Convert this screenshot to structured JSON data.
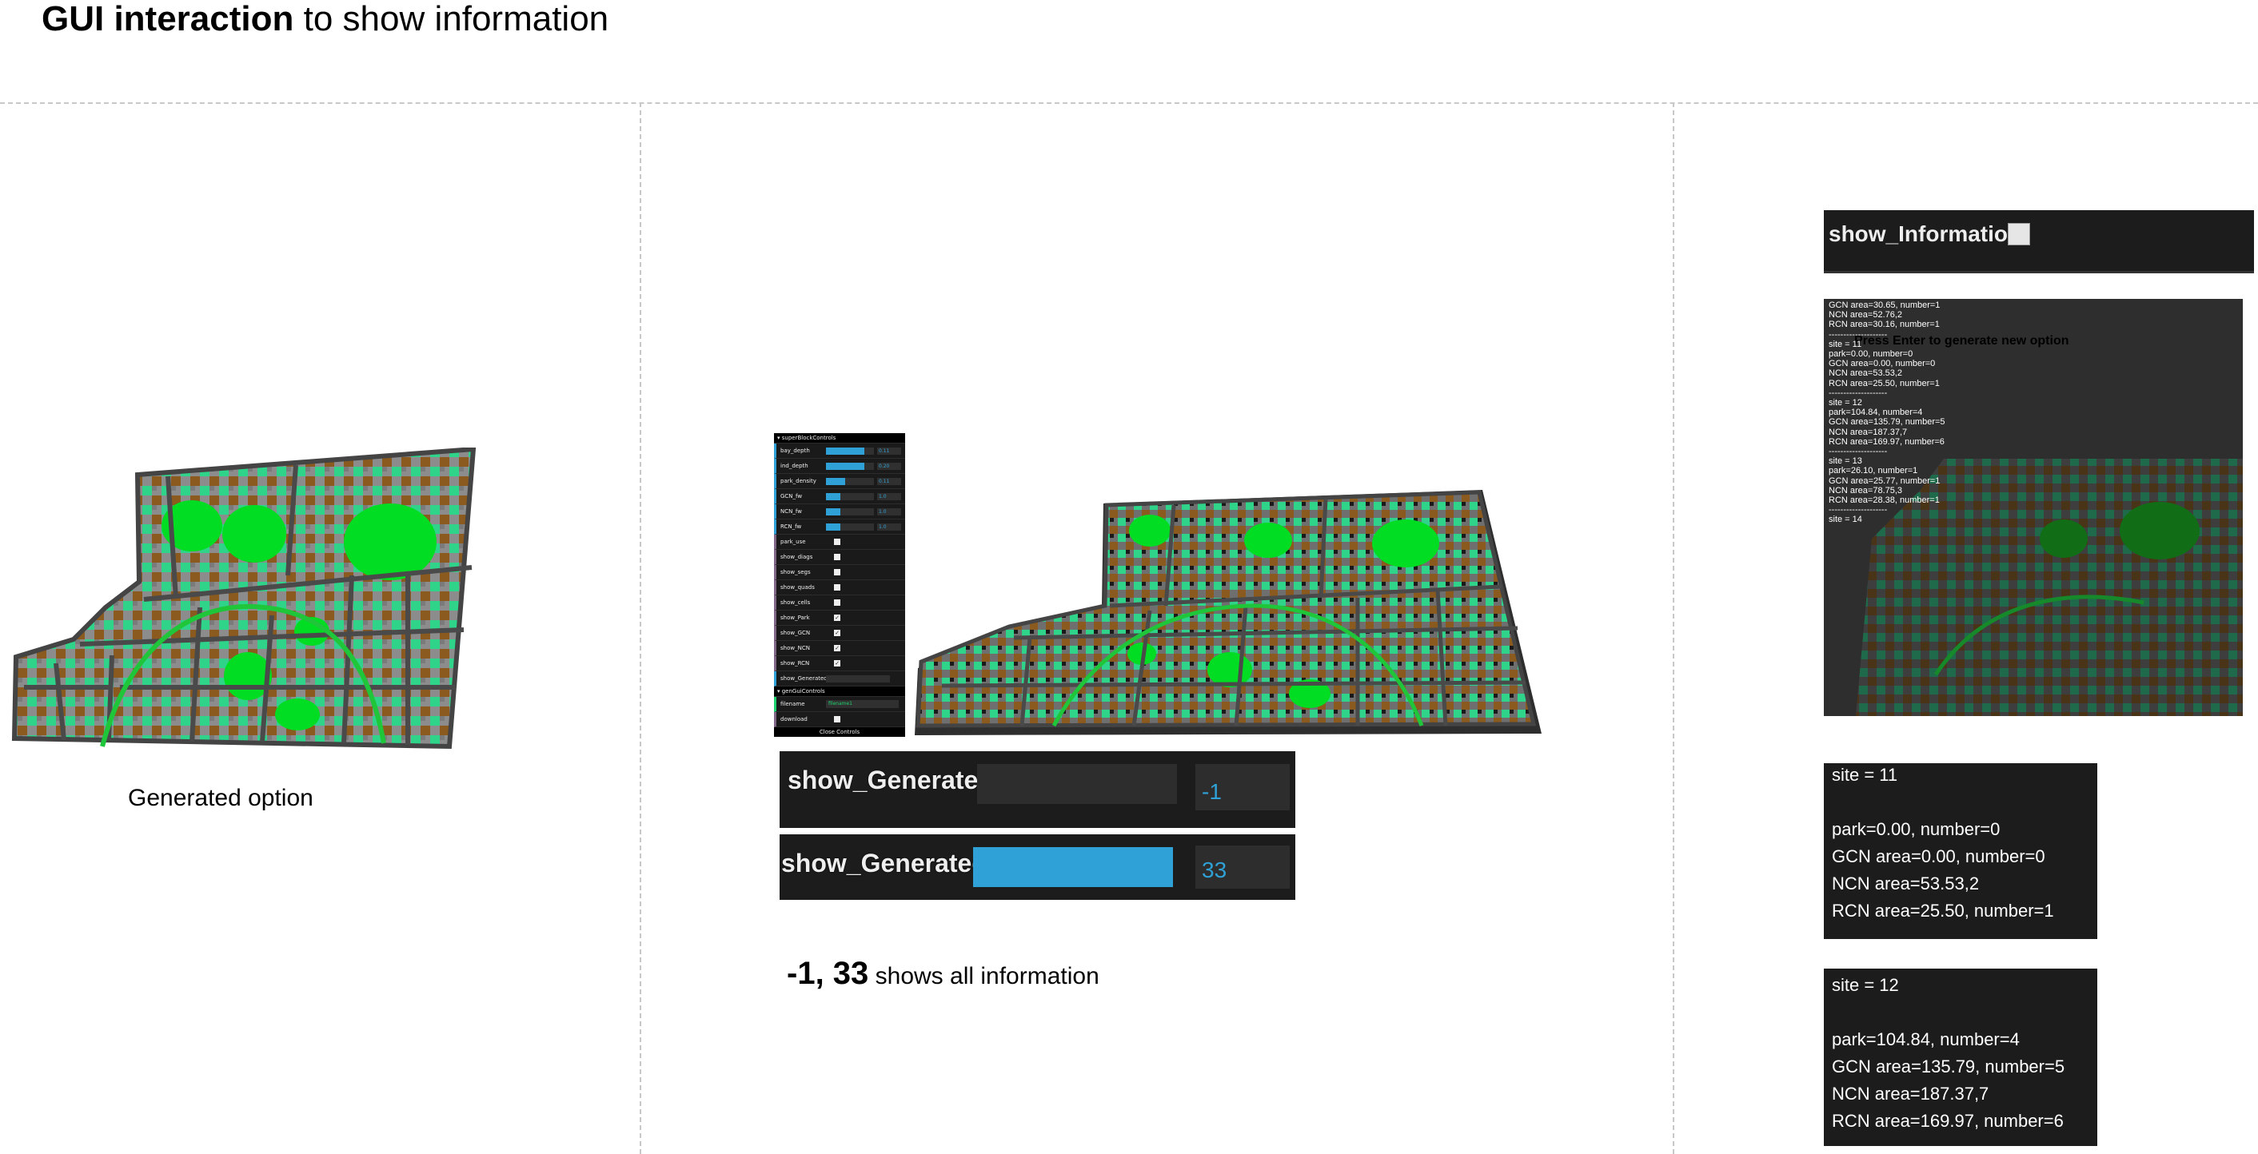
{
  "title": {
    "bold": "GUI interaction",
    "rest": "to show information"
  },
  "captions": {
    "generated": "Generated option",
    "shows_bold": "-1, 33",
    "shows_rest": "shows all information"
  },
  "gui": {
    "folder1": "▾ superBlockControls",
    "number_rows": [
      {
        "label": "bay_depth",
        "value": "0.11",
        "fill": 0.8
      },
      {
        "label": "ind_depth",
        "value": "0.20",
        "fill": 0.8
      },
      {
        "label": "park_density",
        "value": "0.11",
        "fill": 0.4
      },
      {
        "label": "GCN_fw",
        "value": "1.0",
        "fill": 0.3
      },
      {
        "label": "NCN_fw",
        "value": "1.0",
        "fill": 0.3
      },
      {
        "label": "RCN_fw",
        "value": "1.0",
        "fill": 0.3
      }
    ],
    "bool_rows": [
      {
        "label": "park_use",
        "checked": false
      },
      {
        "label": "show_diags",
        "checked": false
      },
      {
        "label": "show_segs",
        "checked": false
      },
      {
        "label": "show_quads",
        "checked": false
      },
      {
        "label": "show_cells",
        "checked": false
      },
      {
        "label": "show_Park",
        "checked": true
      },
      {
        "label": "show_GCN",
        "checked": true
      },
      {
        "label": "show_NCN",
        "checked": true
      },
      {
        "label": "show_RCN",
        "checked": true
      }
    ],
    "generated_label": "show_Generated",
    "folder2": "▾ genGuiControls",
    "filename_label": "filename",
    "filename_value": "filename1",
    "download_label": "download",
    "close": "Close Controls"
  },
  "show_generated": {
    "label": "show_Generated",
    "low_value": "-1",
    "high_value": "33",
    "low_fill": 0,
    "high_fill": 1
  },
  "show_information": {
    "label": "show_Information",
    "checked": false
  },
  "info_overlay": {
    "press_enter": "Press Enter to generate new option",
    "lines": [
      "GCN area=30.65, number=1",
      "NCN area=52.76,2",
      "RCN area=30.16, number=1",
      "--------------------",
      "site = 11",
      "park=0.00, number=0",
      "GCN area=0.00, number=0",
      "NCN area=53.53,2",
      "RCN area=25.50, number=1",
      "--------------------",
      "site = 12",
      "park=104.84, number=4",
      "GCN area=135.79, number=5",
      "NCN area=187.37,7",
      "RCN area=169.97, number=6",
      "--------------------",
      "site = 13",
      "park=26.10, number=1",
      "GCN area=25.77, number=1",
      "NCN area=78.75,3",
      "RCN area=28.38, number=1",
      "--------------------",
      "site = 14"
    ]
  },
  "site11": {
    "site": "site = 11",
    "park": "park=0.00, number=0",
    "gcn": "GCN area=0.00, number=0",
    "ncn": "NCN area=53.53,2",
    "rcn": "RCN area=25.50, number=1"
  },
  "site12": {
    "site": "site = 12",
    "park": "park=104.84, number=4",
    "gcn": "GCN area=135.79, number=5",
    "ncn": "NCN area=187.37,7",
    "rcn": "RCN area=169.97, number=6"
  },
  "colors": {
    "road": "#555555",
    "park": "#00dd22",
    "gcn": "#2fd38a",
    "ncn": "#8a5a1e",
    "rcn": "#8c8c8c",
    "gui_blue": "#2fa1d6"
  }
}
